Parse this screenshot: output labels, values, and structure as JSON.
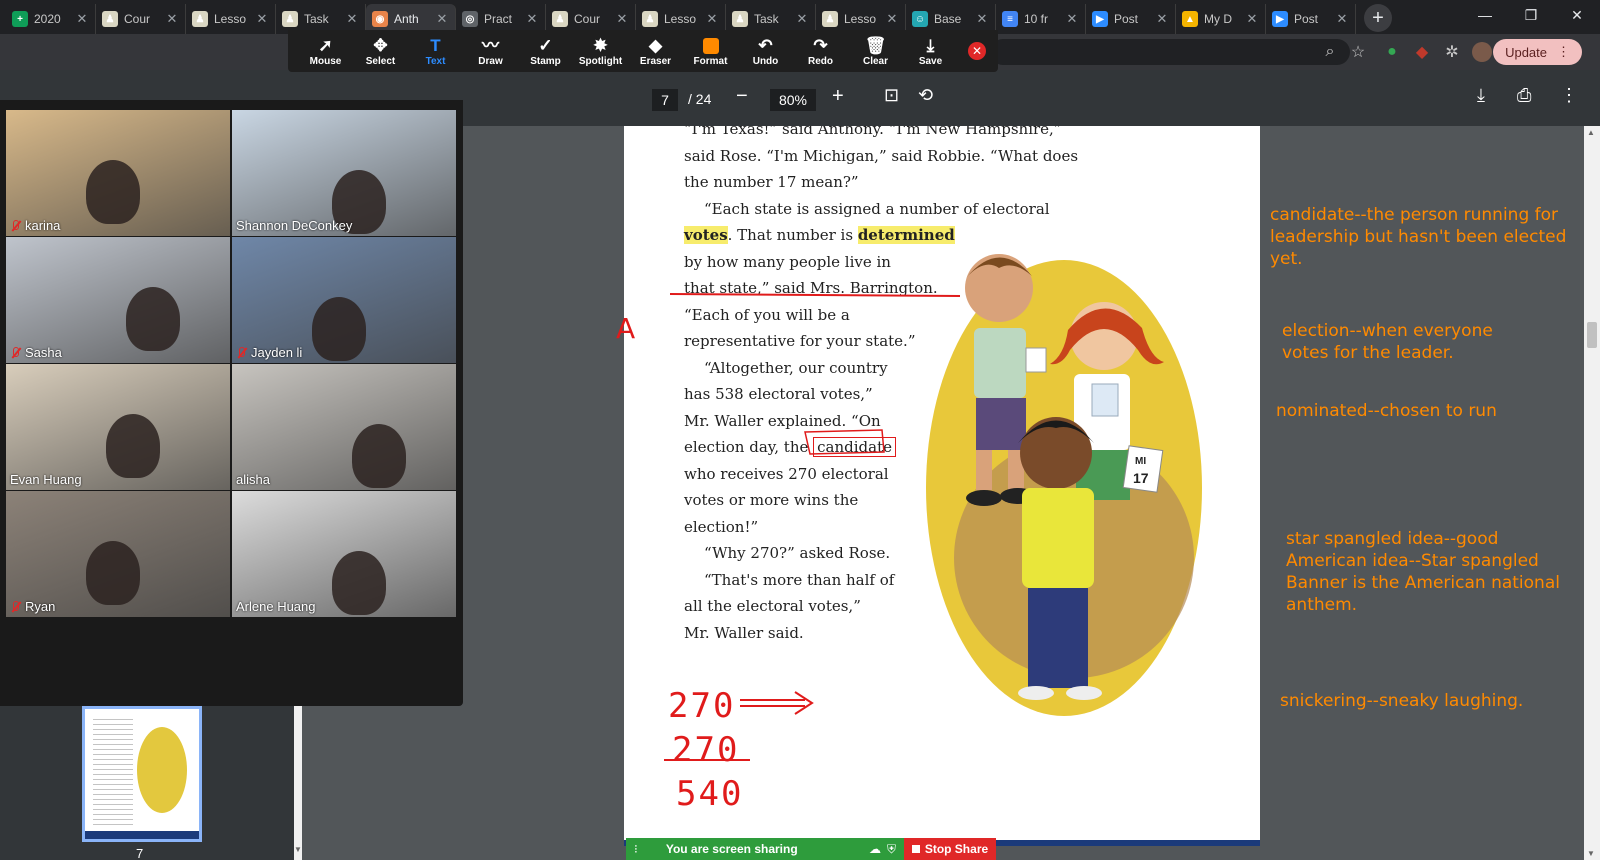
{
  "browser": {
    "tabs": [
      {
        "title": "2020",
        "icon_color": "#0f9d58",
        "icon_glyph": "+"
      },
      {
        "title": "Cour",
        "icon_color": "#d9d6c3",
        "icon_glyph": "♟"
      },
      {
        "title": "Lesso",
        "icon_color": "#d9d6c3",
        "icon_glyph": "♟"
      },
      {
        "title": "Task",
        "icon_color": "#d9d6c3",
        "icon_glyph": "♟"
      },
      {
        "title": "Anth",
        "icon_color": "#e8844a",
        "icon_glyph": "◉",
        "active": true
      },
      {
        "title": "Pract",
        "icon_color": "#5f6368",
        "icon_glyph": "◎"
      },
      {
        "title": "Cour",
        "icon_color": "#d9d6c3",
        "icon_glyph": "♟"
      },
      {
        "title": "Lesso",
        "icon_color": "#d9d6c3",
        "icon_glyph": "♟"
      },
      {
        "title": "Task",
        "icon_color": "#d9d6c3",
        "icon_glyph": "♟"
      },
      {
        "title": "Lesso",
        "icon_color": "#d9d6c3",
        "icon_glyph": "♟"
      },
      {
        "title": "Base",
        "icon_color": "#24a7b3",
        "icon_glyph": "☺"
      },
      {
        "title": "10 fr",
        "icon_color": "#4285f4",
        "icon_glyph": "≡"
      },
      {
        "title": "Post",
        "icon_color": "#2d8cff",
        "icon_glyph": "▶"
      },
      {
        "title": "My D",
        "icon_color": "#f4b400",
        "icon_glyph": "▲"
      },
      {
        "title": "Post",
        "icon_color": "#2d8cff",
        "icon_glyph": "▶"
      }
    ],
    "update_label": "Update"
  },
  "annotation_toolbar": {
    "tools": [
      {
        "label": "Mouse",
        "icon": "cursor-icon",
        "glyph": "➚"
      },
      {
        "label": "Select",
        "icon": "move-icon",
        "glyph": "✥"
      },
      {
        "label": "Text",
        "icon": "text-icon",
        "glyph": "T",
        "active": true
      },
      {
        "label": "Draw",
        "icon": "draw-icon",
        "glyph": "〰"
      },
      {
        "label": "Stamp",
        "icon": "checkmark-icon",
        "glyph": "✓"
      },
      {
        "label": "Spotlight",
        "icon": "spotlight-icon",
        "glyph": "✸"
      },
      {
        "label": "Eraser",
        "icon": "eraser-icon",
        "glyph": "◆"
      },
      {
        "label": "Format",
        "icon": "format-icon",
        "glyph": ""
      },
      {
        "label": "Undo",
        "icon": "undo-icon",
        "glyph": "↶"
      },
      {
        "label": "Redo",
        "icon": "redo-icon",
        "glyph": "↷"
      },
      {
        "label": "Clear",
        "icon": "trash-icon",
        "glyph": "🗑"
      },
      {
        "label": "Save",
        "icon": "save-icon",
        "glyph": "⤓"
      }
    ],
    "format_color": "#ff8a00"
  },
  "pdf": {
    "current_page": "7",
    "total_pages": "/ 24",
    "zoom": "80%",
    "thumbnail_label": "7"
  },
  "story": {
    "lines": [
      "“I'm Texas!” said Anthony. “I'm New Hampshire,”",
      "said Rose. “I'm Michigan,” said Robbie. “What does",
      "the number 17 mean?”"
    ],
    "para2_pre": "“Each state is assigned a number of electoral",
    "word_votes": "votes",
    "para2_mid": ". That number is ",
    "word_determined": "determined",
    "para2_rest": [
      "by how many people live in",
      "that state,” said Mrs. Barrington.",
      "“Each of you will be a",
      "representative for your state.”"
    ],
    "para3": [
      "“Altogether, our country",
      "has 538 electoral votes,”",
      "Mr. Waller explained. “On"
    ],
    "para3_pre": "election day, the ",
    "word_candidate": "candidate",
    "para3_rest": [
      "who receives 270 electoral",
      "votes or more wins the",
      "election!”"
    ],
    "para4": "“Why 270?” asked Rose.",
    "para5": [
      "“That's more than half of",
      "all the electoral votes,”",
      "Mr. Waller said."
    ],
    "sign_state": "MI",
    "sign_number": "17"
  },
  "ink": {
    "letter": "A",
    "sum_line1": "270",
    "sum_line2": "270",
    "sum_total": "540"
  },
  "notes": {
    "candidate": "candidate--the person running for leadership but hasn't been elected yet.",
    "election": "election--when everyone votes for the leader.",
    "nominated": "nominated--chosen to run",
    "star_spangled": "star spangled idea--good American idea--Star spangled Banner is the American national anthem.",
    "snickering": "snickering--sneaky laughing."
  },
  "gallery": {
    "participants": [
      {
        "name": "karina",
        "muted": true,
        "bg": "#d8b98a"
      },
      {
        "name": "Shannon DeConkey",
        "muted": false,
        "bg": "#c9d6e3"
      },
      {
        "name": "Sasha",
        "muted": true,
        "bg": "#bfc4cc"
      },
      {
        "name": "Jayden li",
        "muted": true,
        "bg": "#6f87a8"
      },
      {
        "name": "Evan Huang",
        "muted": false,
        "bg": "#d8cdbb"
      },
      {
        "name": "alisha",
        "muted": false,
        "bg": "#c7c4bf",
        "speaking": true
      },
      {
        "name": "Ryan",
        "muted": true,
        "bg": "#8c8278"
      },
      {
        "name": "Arlene Huang",
        "muted": false,
        "bg": "#dcdcdc"
      }
    ]
  },
  "share": {
    "status": "You are screen sharing",
    "stop_label": "Stop Share"
  }
}
